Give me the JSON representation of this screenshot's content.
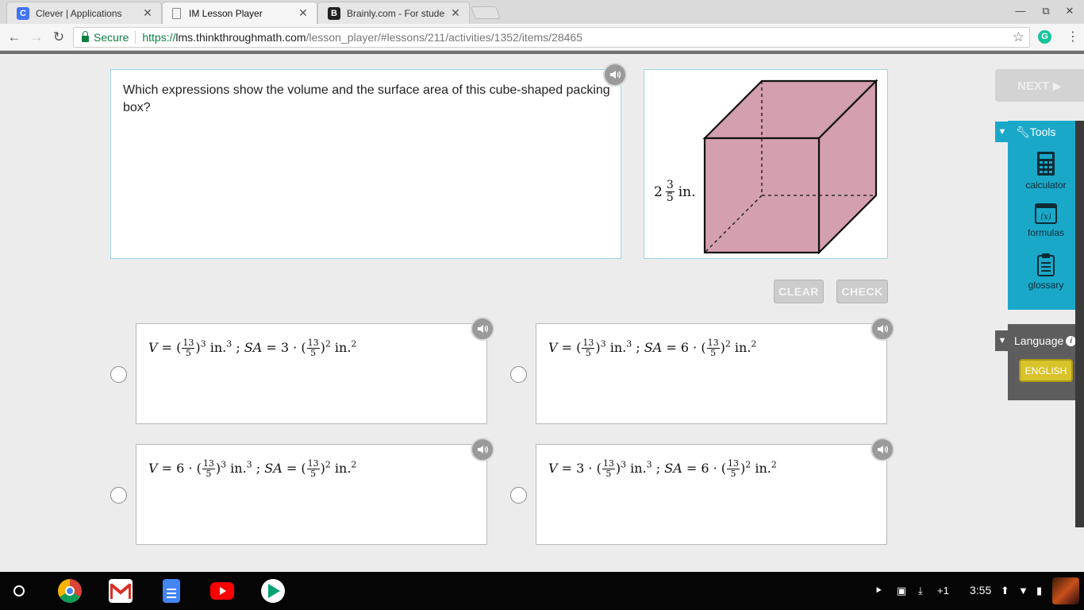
{
  "browser": {
    "tabs": [
      {
        "title": "Clever | Applications",
        "active": false
      },
      {
        "title": "IM Lesson Player",
        "active": true
      },
      {
        "title": "Brainly.com - For studen",
        "active": false
      }
    ],
    "security_label": "Secure",
    "url": {
      "protocol": "https://",
      "host": "lms.thinkthroughmath.com",
      "path": "/lesson_player/#lessons/211/activities/1352/items/28465"
    }
  },
  "question": {
    "text": "Which expressions show the volume and the surface area of this cube-shaped packing box?",
    "figure": {
      "whole": "2",
      "numerator": "3",
      "denominator": "5",
      "unit": "in.",
      "cube_fill": "#d49fae"
    }
  },
  "actions": {
    "clear_label": "CLEAR",
    "check_label": "CHECK",
    "next_label": "NEXT ▶"
  },
  "choices": [
    {
      "v_coef": "",
      "v_num": "13",
      "v_den": "5",
      "v_exp": "3",
      "sa_coef": "3 ·",
      "sa_num": "13",
      "sa_den": "5",
      "sa_exp": "2"
    },
    {
      "v_coef": "",
      "v_num": "13",
      "v_den": "5",
      "v_exp": "3",
      "sa_coef": "6 ·",
      "sa_num": "13",
      "sa_den": "5",
      "sa_exp": "2"
    },
    {
      "v_coef": "6 ·",
      "v_num": "13",
      "v_den": "5",
      "v_exp": "3",
      "sa_coef": "",
      "sa_num": "13",
      "sa_den": "5",
      "sa_exp": "2"
    },
    {
      "v_coef": "3 ·",
      "v_num": "13",
      "v_den": "5",
      "v_exp": "3",
      "sa_coef": "6 ·",
      "sa_num": "13",
      "sa_den": "5",
      "sa_exp": "2"
    }
  ],
  "tools": {
    "header": "Tools",
    "items": [
      {
        "label": "calculator",
        "icon": "calculator-icon"
      },
      {
        "label": "formulas",
        "icon": "formulas-icon"
      },
      {
        "label": "glossary",
        "icon": "glossary-icon"
      }
    ]
  },
  "language": {
    "header": "Language",
    "selected": "ENGLISH"
  },
  "taskbar": {
    "notification_count": "+1",
    "time": "3:55"
  },
  "colors": {
    "tools_panel": "#1aa8c9",
    "language_panel": "#5d5d5d",
    "english_button": "#d9c32a",
    "card_border": "#9fd3e0"
  }
}
